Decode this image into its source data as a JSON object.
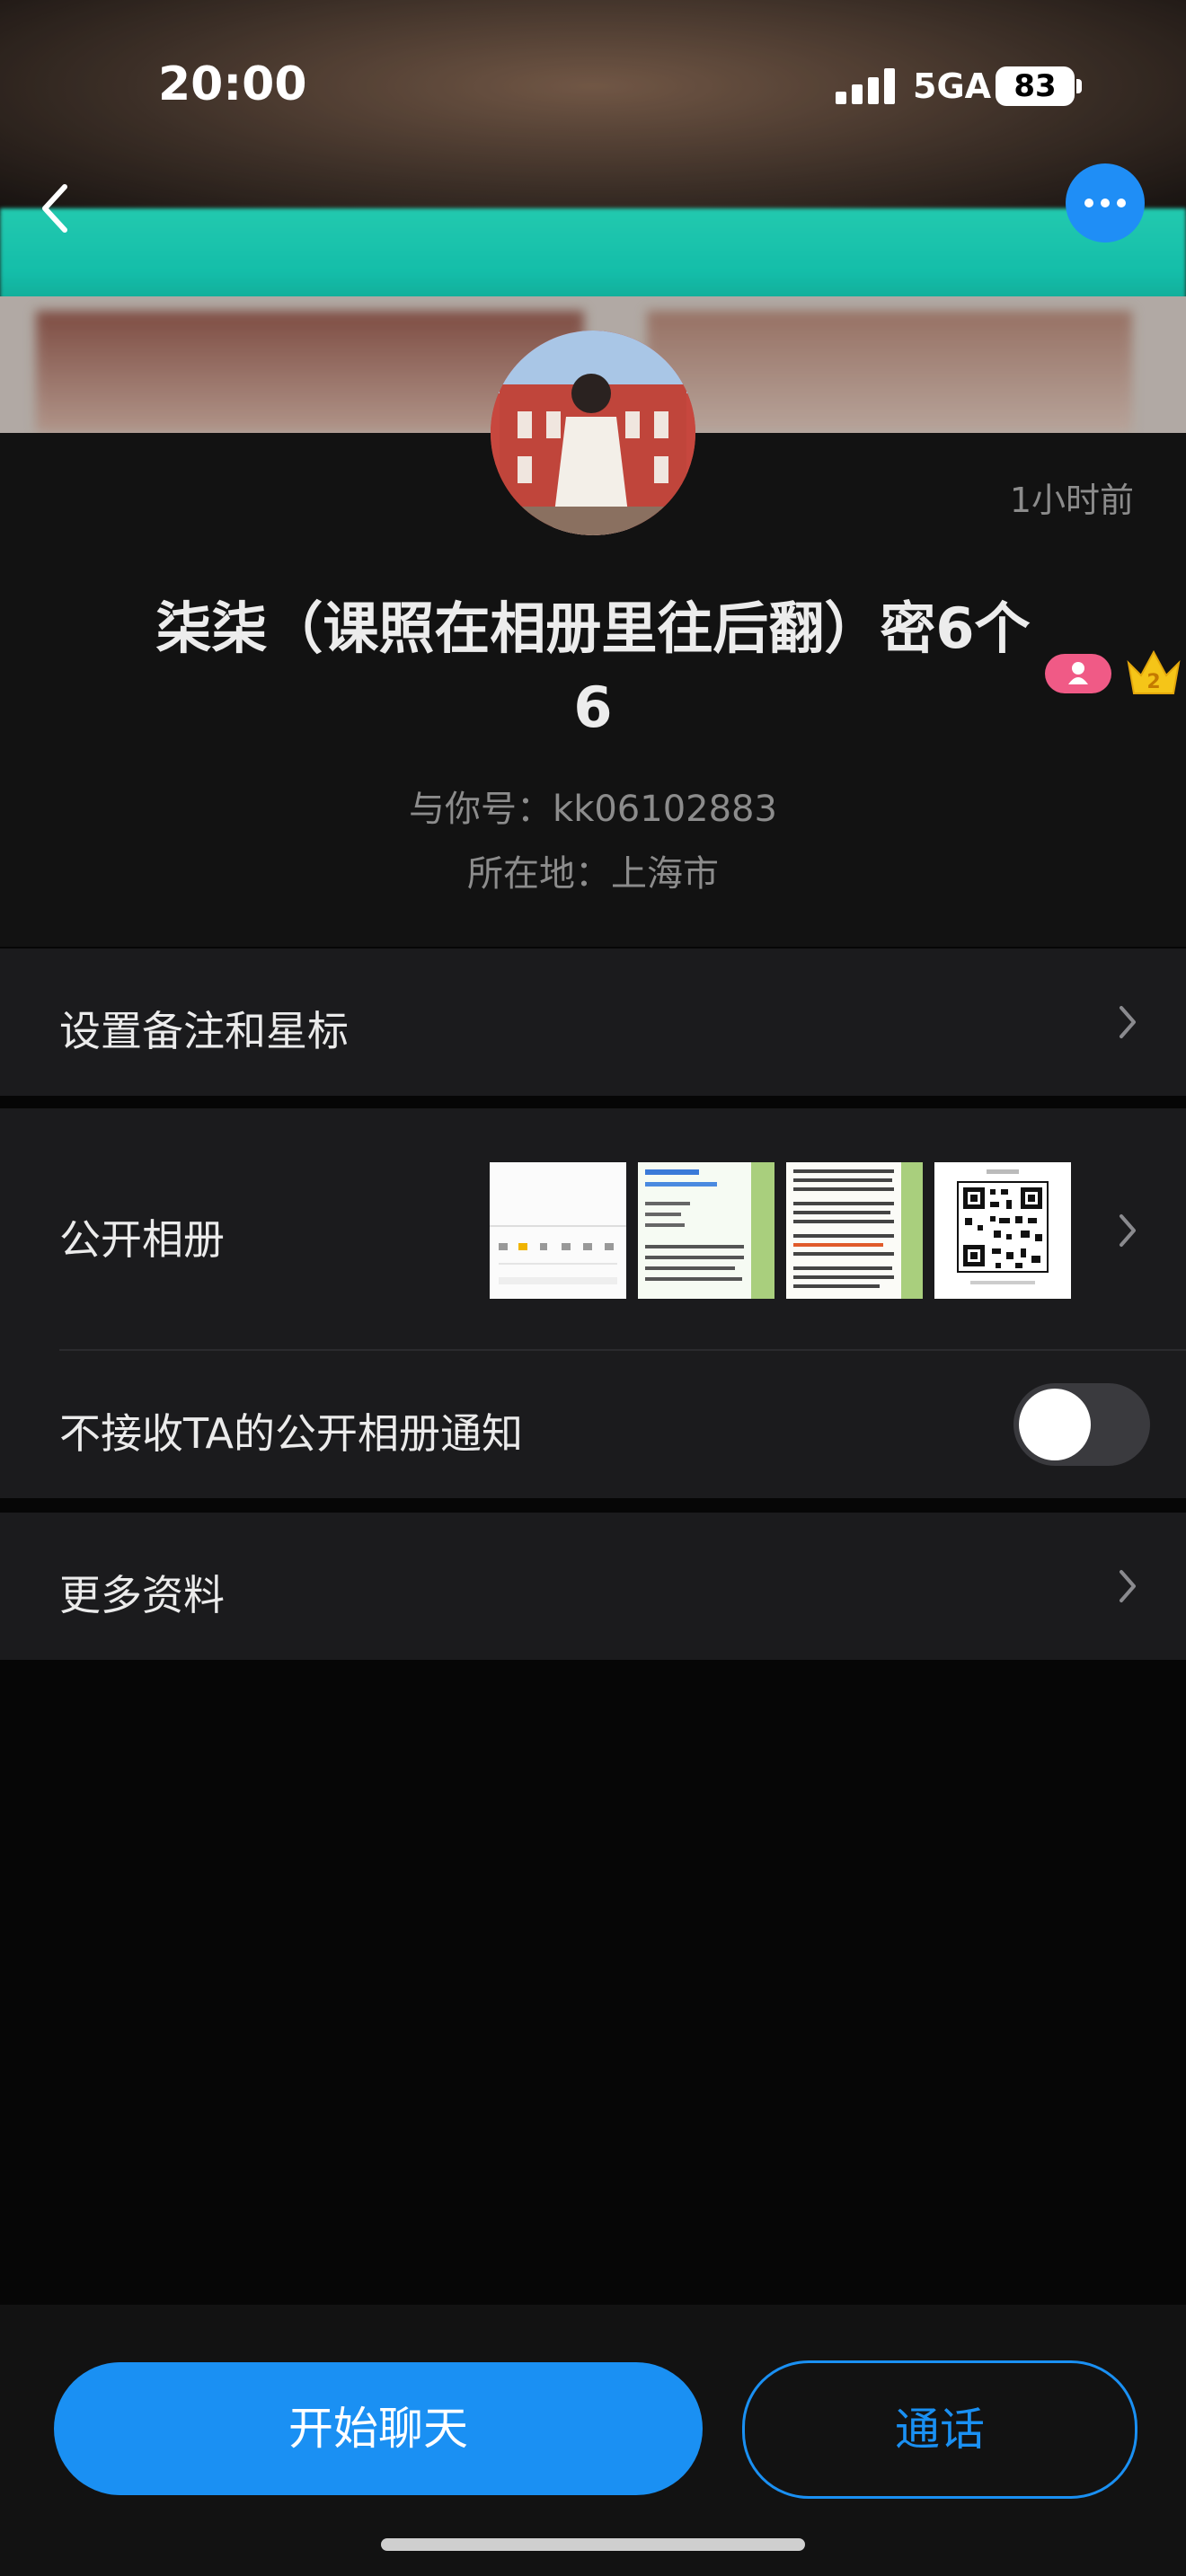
{
  "status_bar": {
    "time": "20:00",
    "network": "5GA",
    "battery": "83"
  },
  "profile": {
    "time_ago": "1小时前",
    "nickname": "柒柒（课照在相册里往后翻）密6个6",
    "account": "与你号：kk06102883",
    "location": "所在地：上海市",
    "crown_level": "2"
  },
  "menu": {
    "remark_label": "设置备注和星标",
    "album_label": "公开相册",
    "notify_label": "不接收TA的公开相册通知",
    "notify_toggle_on": false,
    "more_label": "更多资料"
  },
  "actions": {
    "chat_label": "开始聊天",
    "call_label": "通话"
  },
  "colors": {
    "accent": "#1a90f3",
    "badge_pink": "#f05a86",
    "crown": "#f5c518"
  },
  "icons": [
    "back-arrow-icon",
    "more-dots-icon",
    "chevron-right-icon",
    "crown-icon",
    "person-badge-icon"
  ]
}
